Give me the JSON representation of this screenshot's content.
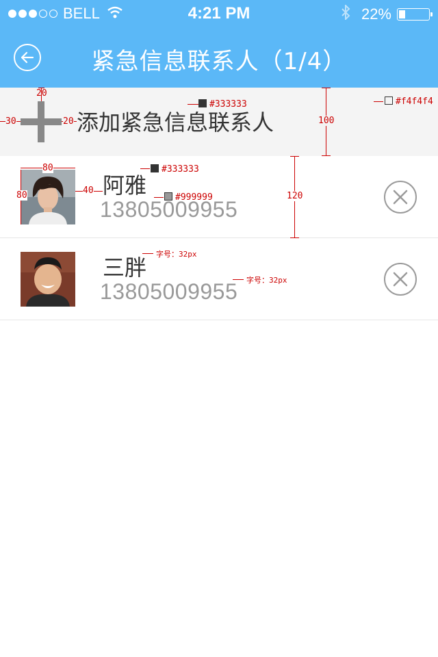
{
  "status_bar": {
    "carrier": "BELL",
    "time": "4:21 PM",
    "battery": "22%",
    "battery_level": 0.22,
    "signal_dots_filled": 3,
    "signal_dots_total": 5
  },
  "nav": {
    "title": "紧急信息联系人（1/4）",
    "back_icon": "arrow-left-icon"
  },
  "add_row": {
    "label": "添加紧急信息联系人",
    "icon": "plus-icon"
  },
  "contacts": [
    {
      "name": "阿雅",
      "phone": "13805009955",
      "delete_icon": "circle-x-icon"
    },
    {
      "name": "三胖",
      "phone": "13805009955",
      "delete_icon": "circle-x-icon"
    }
  ],
  "annotations": {
    "add_icon_top": "20",
    "add_icon_left": "30",
    "add_icon_right": "20",
    "add_label_color": "#333333",
    "page_bg_color": "#f4f4f4",
    "add_row_height": "100",
    "avatar_width": "80",
    "avatar_height": "80",
    "avatar_gap": "40",
    "name_color": "#333333",
    "phone_color": "#999999",
    "row_height": "120",
    "name_font": "字号：32px",
    "phone_font": "字号：32px"
  },
  "colors": {
    "primary": "#5bb8f7",
    "text_dark": "#333333",
    "text_light": "#999999",
    "add_bg": "#f4f4f4",
    "icon_gray": "#888888",
    "annotation": "#cc0000"
  }
}
